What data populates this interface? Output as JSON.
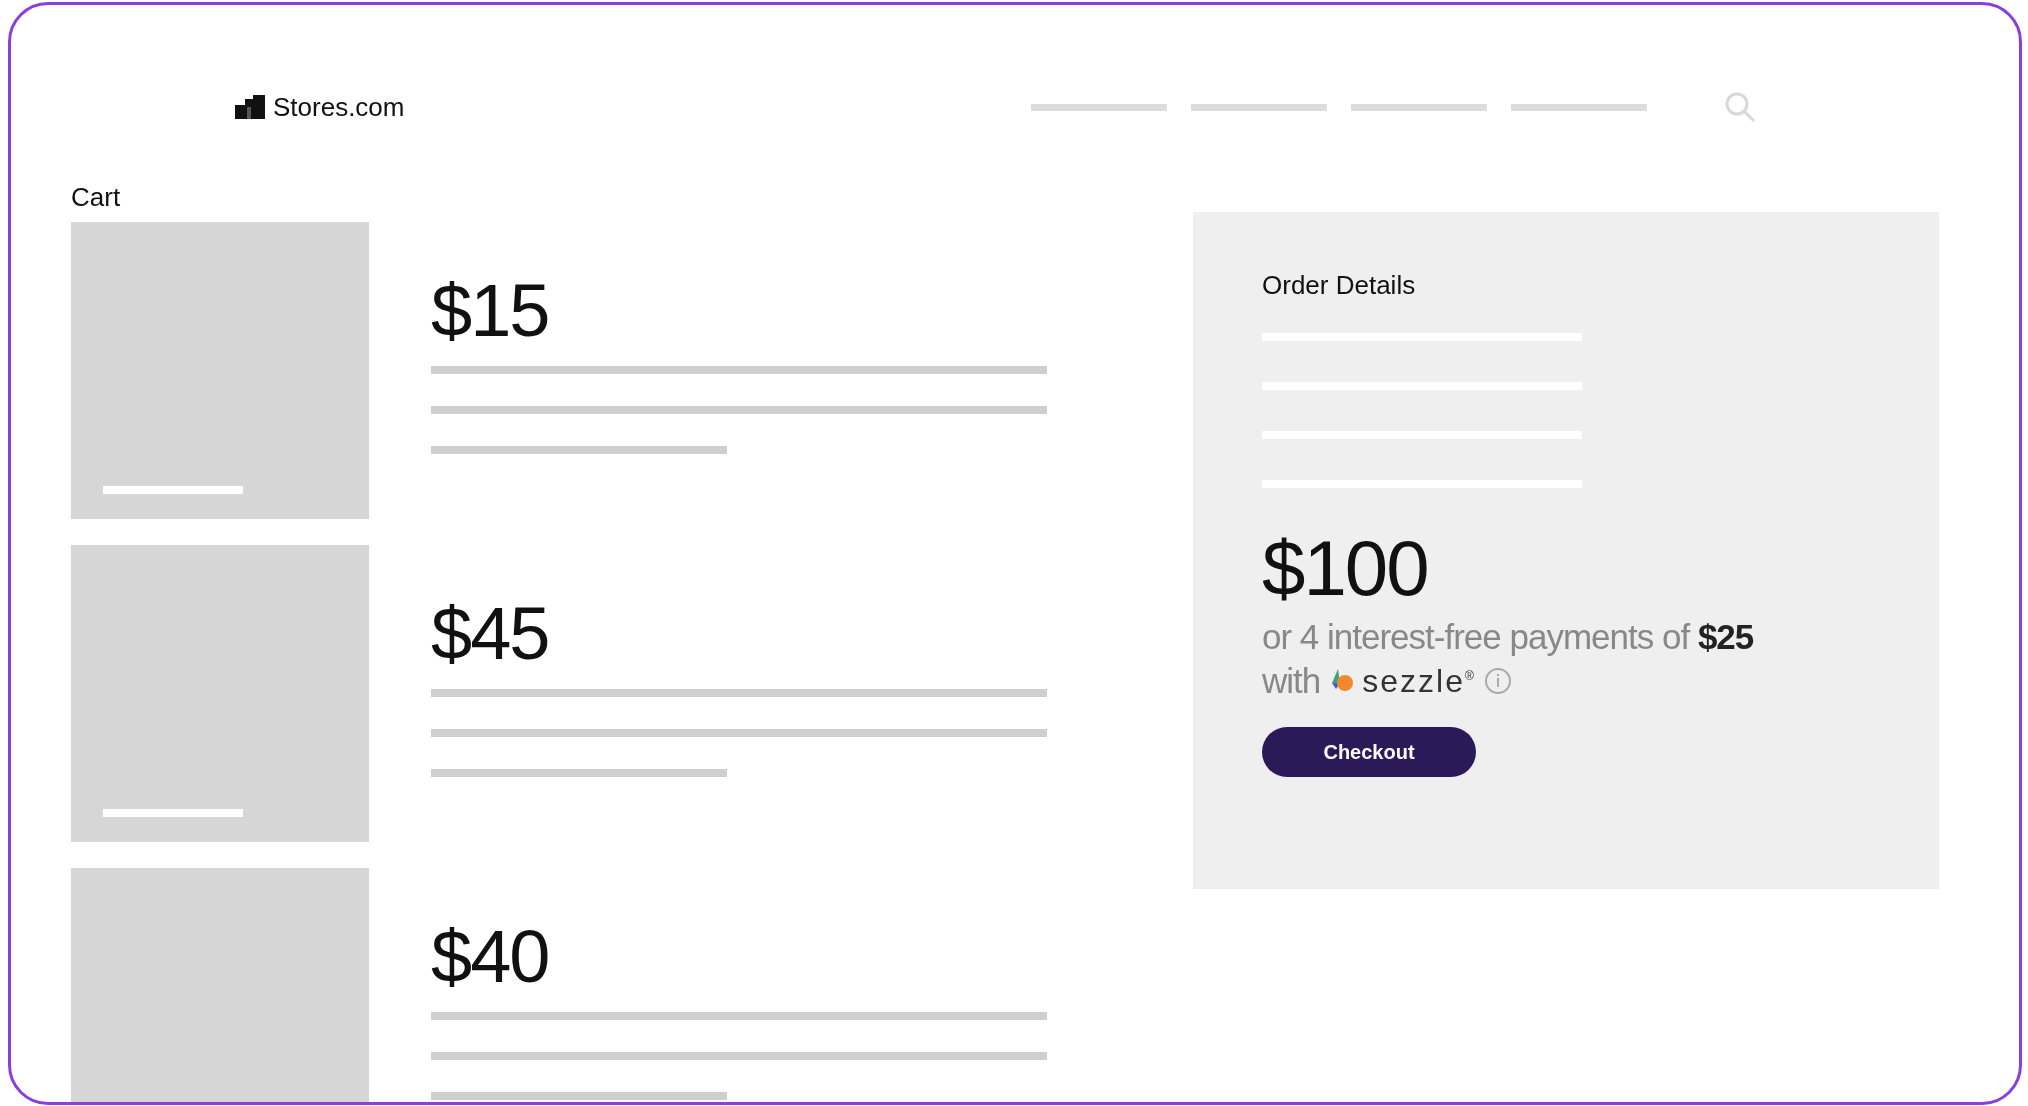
{
  "header": {
    "logo": "Stores.com"
  },
  "cart": {
    "title": "Cart",
    "items": [
      {
        "price": "$15"
      },
      {
        "price": "$45"
      },
      {
        "price": "$40"
      }
    ]
  },
  "order": {
    "title": "Order Details",
    "total": "$100",
    "installments": "or 4 interest-free payments of **$25**",
    "with_text": "with",
    "brand": "sezzle$^{®}$",
    "button": "Checkout"
  }
}
